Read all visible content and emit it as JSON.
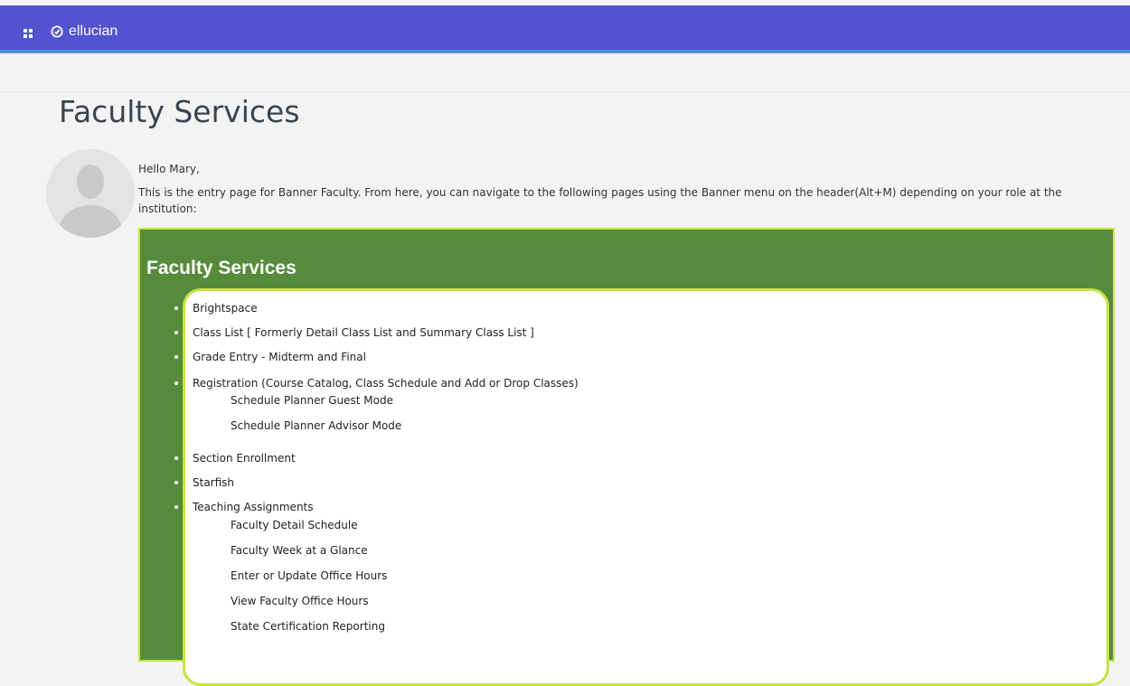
{
  "header": {
    "brand": "ellucian",
    "colors": {
      "bar": "#5253cf",
      "underline": "#4f8fd6"
    }
  },
  "page": {
    "title": "Faculty Services",
    "greeting": "Hello Mary,",
    "intro": "This is the entry page for Banner Faculty. From here, you can navigate to the following pages using the Banner menu on the header(Alt+M) depending on your role at the institution:"
  },
  "panel": {
    "title": "Faculty Services",
    "colors": {
      "background": "#558b3a",
      "border": "#c6e33f"
    },
    "items": [
      {
        "label": "Brightspace"
      },
      {
        "label": "Class List [ Formerly Detail Class List and Summary Class List ]"
      },
      {
        "label": "Grade Entry - Midterm and Final"
      },
      {
        "label": "Registration (Course Catalog, Class Schedule and Add or Drop Classes)"
      },
      {
        "label": "Section Enrollment"
      },
      {
        "label": "Starfish"
      },
      {
        "label": "Teaching Assignments"
      }
    ],
    "registration_sub": [
      "Schedule Planner Guest Mode",
      "Schedule Planner Advisor Mode"
    ],
    "teaching_sub": [
      "Faculty Detail Schedule",
      "Faculty Week at a Glance",
      "Enter or Update Office Hours",
      "View Faculty Office Hours",
      "State Certification Reporting"
    ]
  }
}
